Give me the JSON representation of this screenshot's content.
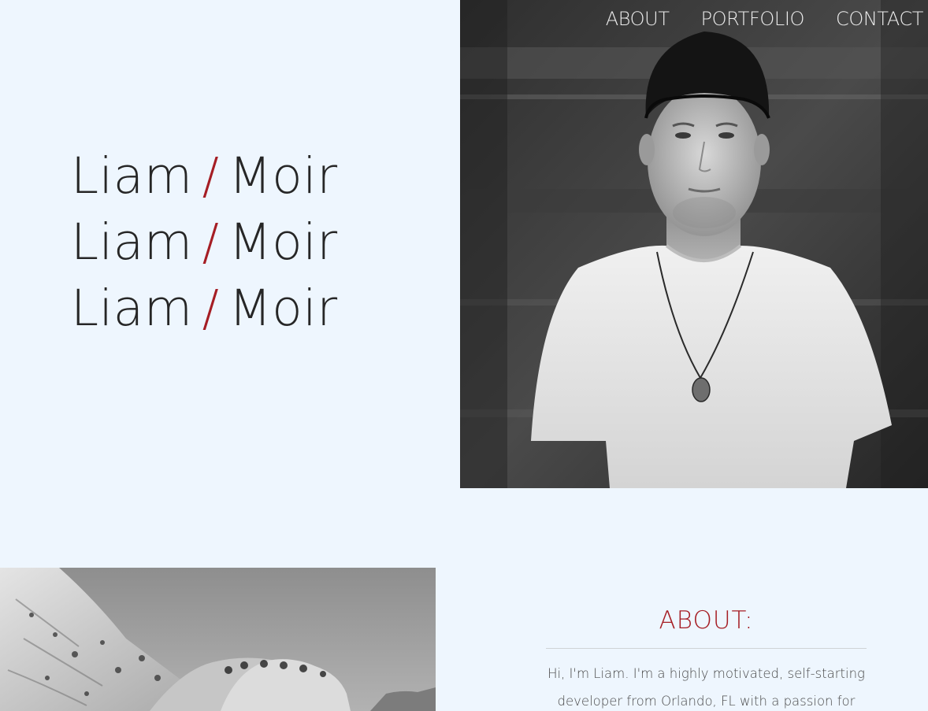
{
  "nav": {
    "items": [
      {
        "label": "ABOUT"
      },
      {
        "label": "PORTFOLIO"
      },
      {
        "label": "CONTACT"
      }
    ]
  },
  "hero": {
    "lines": [
      {
        "first": "Liam",
        "sep": "/",
        "last": "Moir"
      },
      {
        "first": "Liam",
        "sep": "/",
        "last": "Moir"
      },
      {
        "first": "Liam",
        "sep": "/",
        "last": "Moir"
      }
    ]
  },
  "about": {
    "title": "ABOUT:",
    "text": "Hi, I'm Liam. I'm a highly motivated, self-starting developer from Orlando, FL with a passion for"
  },
  "colors": {
    "background": "#eef6fe",
    "accent": "#a51d24",
    "text": "#262626"
  }
}
